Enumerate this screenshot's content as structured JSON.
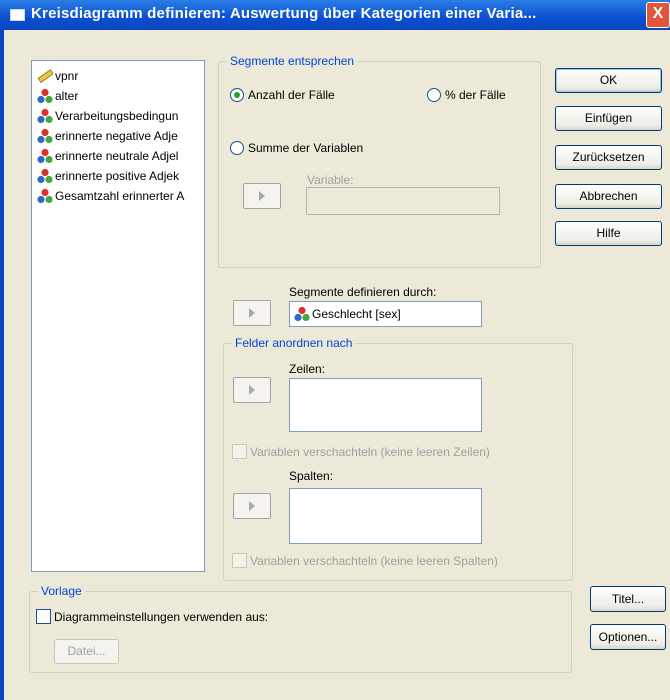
{
  "window": {
    "title": "Kreisdiagramm definieren: Auswertung über Kategorien einer Varia...",
    "close_label": "X"
  },
  "variables": [
    {
      "label": "vpnr",
      "icon": "ruler-icon"
    },
    {
      "label": "alter",
      "icon": "nominal-variable-icon"
    },
    {
      "label": "Verarbeitungsbedingun",
      "icon": "nominal-variable-icon"
    },
    {
      "label": "erinnerte negative Adje",
      "icon": "nominal-variable-icon"
    },
    {
      "label": "erinnerte neutrale Adjel",
      "icon": "nominal-variable-icon"
    },
    {
      "label": "erinnerte positive Adjek",
      "icon": "nominal-variable-icon"
    },
    {
      "label": "Gesamtzahl erinnerter A",
      "icon": "nominal-variable-icon"
    }
  ],
  "segments_group": {
    "title": "Segmente entsprechen",
    "radio_count": "Anzahl der Fälle",
    "radio_percent": "% der Fälle",
    "radio_sum": "Summe der Variablen",
    "variable_label": "Variable:",
    "selected": "Anzahl der Fälle"
  },
  "define_by": {
    "label": "Segmente definieren durch:",
    "value": "Geschlecht [sex]"
  },
  "panels_group": {
    "title": "Felder anordnen nach",
    "rows_label": "Zeilen:",
    "nest_rows": "Variablen verschachteln (keine leeren Zeilen)",
    "columns_label": "Spalten:",
    "nest_columns": "Variablen verschachteln (keine leeren Spalten)"
  },
  "template_group": {
    "title": "Vorlage",
    "use_settings": "Diagrammeinstellungen verwenden aus:",
    "file_button": "Datei..."
  },
  "buttons": {
    "ok": "OK",
    "paste": "Einfügen",
    "reset": "Zurücksetzen",
    "cancel": "Abbrechen",
    "help": "Hilfe",
    "titles": "Titel...",
    "options": "Optionen..."
  },
  "colors": {
    "title_bar": "#0a4fd0",
    "dialog_bg": "#ece9d8",
    "group_title": "#0046d5",
    "radio_selected": "#21a121"
  }
}
